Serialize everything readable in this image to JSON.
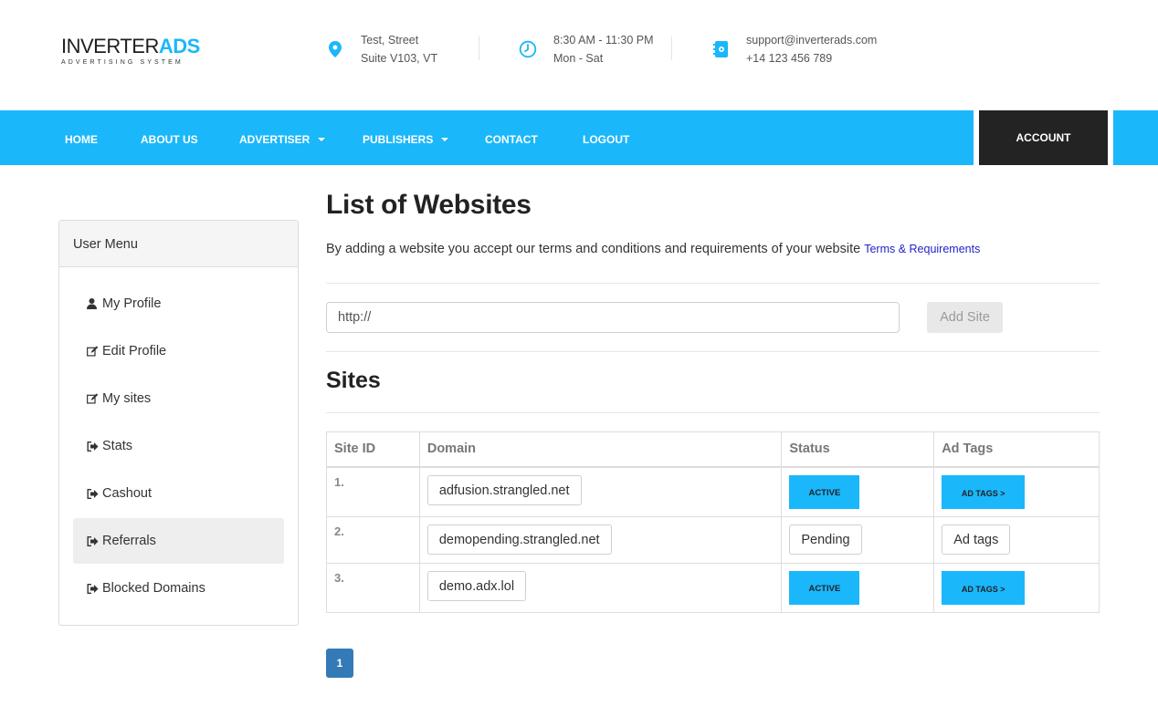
{
  "brand": {
    "name_main": "INVERTER",
    "name_accent": "ADS",
    "tagline": "ADVERTISING SYSTEM",
    "accent_color": "#1ab7fb"
  },
  "contact": {
    "address": {
      "icon": "map-pin-icon",
      "line1": "Test, Street",
      "line2": "Suite V103, VT"
    },
    "hours": {
      "icon": "clock-icon",
      "line1": "8:30 AM - 11:30 PM",
      "line2": "Mon - Sat"
    },
    "support": {
      "icon": "contact-book-icon",
      "line1": "support@inverterads.com",
      "line2": "+14 123 456 789"
    }
  },
  "nav": {
    "items": [
      {
        "label": "HOME"
      },
      {
        "label": "ABOUT US"
      },
      {
        "label": "ADVERTISER",
        "dropdown": true
      },
      {
        "label": "PUBLISHERS",
        "dropdown": true
      },
      {
        "label": "CONTACT"
      },
      {
        "label": "LOGOUT"
      }
    ],
    "account_label": "ACCOUNT"
  },
  "sidebar": {
    "title": "User Menu",
    "items": [
      {
        "label": "My Profile",
        "icon": "user-icon"
      },
      {
        "label": "Edit Profile",
        "icon": "edit-icon"
      },
      {
        "label": "My sites",
        "icon": "edit-icon"
      },
      {
        "label": "Stats",
        "icon": "sign-out-icon"
      },
      {
        "label": "Cashout",
        "icon": "sign-out-icon"
      },
      {
        "label": "Referrals",
        "icon": "sign-out-icon",
        "active": true
      },
      {
        "label": "Blocked Domains",
        "icon": "sign-out-icon"
      }
    ]
  },
  "main": {
    "title": "List of Websites",
    "intro": "By adding a website you accept our terms and conditions and requirements of your website",
    "terms_link": "Terms & Requirements",
    "url_input": {
      "value": "http://",
      "placeholder": ""
    },
    "add_site_label": "Add Site",
    "sites_title": "Sites",
    "table": {
      "headers": [
        "Site ID",
        "Domain",
        "Status",
        "Ad Tags"
      ],
      "rows": [
        {
          "id": "1.",
          "domain": "adfusion.strangled.net",
          "status": "ACTIVE",
          "ad_tags": "AD TAGS >"
        },
        {
          "id": "2.",
          "domain": "demopending.strangled.net",
          "status": "Pending",
          "ad_tags": "Ad tags"
        },
        {
          "id": "3.",
          "domain": "demo.adx.lol",
          "status": "ACTIVE",
          "ad_tags": "AD TAGS >"
        }
      ]
    },
    "pagination": {
      "current": "1"
    }
  }
}
